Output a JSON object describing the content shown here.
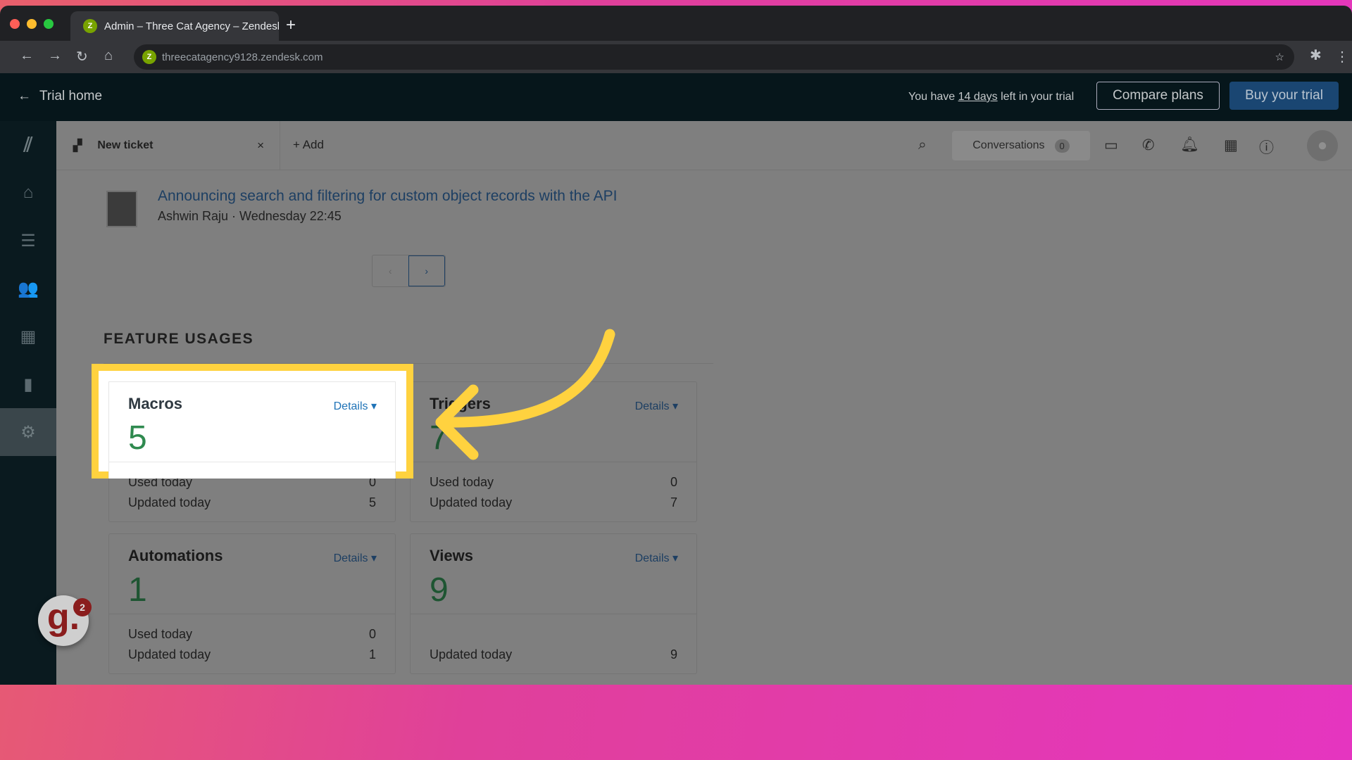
{
  "browser": {
    "tab_title": "Admin – Three Cat Agency – Zendesk",
    "tab_favicon": "Z",
    "url": "threecatagency9128.zendesk.com"
  },
  "trial_bar": {
    "back_label": "Trial home",
    "prefix": "You have ",
    "days": "14 days",
    "suffix": " left in your trial",
    "compare": "Compare plans",
    "buy": "Buy your trial"
  },
  "header": {
    "tab_label": "New ticket",
    "add_label": "Add",
    "conversations_label": "Conversations",
    "conversations_count": "0"
  },
  "announcement": {
    "title": "Announcing search and filtering for custom object records with the API",
    "meta": "Ashwin Raju · Wednesday 22:45",
    "prev": "‹",
    "next": "›"
  },
  "feature_usages": {
    "heading": "FEATURE USAGES",
    "details_label": "Details ▾",
    "cards": [
      {
        "name": "Macros",
        "value": "5",
        "rows": [
          {
            "label": "Used today",
            "value": "0"
          },
          {
            "label": "Updated today",
            "value": "5"
          }
        ]
      },
      {
        "name": "Triggers",
        "value": "7",
        "rows": [
          {
            "label": "Used today",
            "value": "0"
          },
          {
            "label": "Updated today",
            "value": "7"
          }
        ]
      },
      {
        "name": "Automations",
        "value": "1",
        "rows": [
          {
            "label": "Used today",
            "value": "0"
          },
          {
            "label": "Updated today",
            "value": "1"
          }
        ]
      },
      {
        "name": "Views",
        "value": "9",
        "rows": [
          {
            "label": "Updated today",
            "value": "9"
          }
        ]
      }
    ]
  },
  "widget": {
    "logo": "g.",
    "badge": "2"
  },
  "colors": {
    "highlight": "#ffd23f",
    "accent": "#1f73b7",
    "value_green": "#2f8a4f"
  }
}
